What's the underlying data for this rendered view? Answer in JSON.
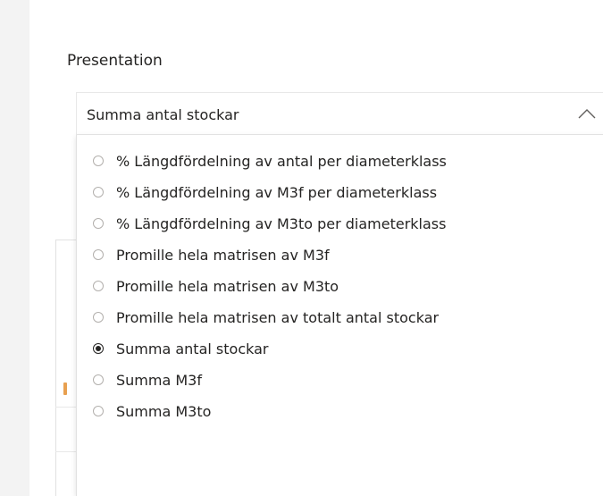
{
  "presentation": {
    "title": "Presentation",
    "selected_value": "Summa antal stockar",
    "chevron_icon": "chevron-up-icon",
    "options": [
      {
        "label": "% Längdfördelning av antal per diameterklass",
        "selected": false
      },
      {
        "label": "% Längdfördelning av M3f per diameterklass",
        "selected": false
      },
      {
        "label": "% Längdfördelning av M3to per diameterklass",
        "selected": false
      },
      {
        "label": "Promille hela matrisen av M3f",
        "selected": false
      },
      {
        "label": "Promille hela matrisen av M3to",
        "selected": false
      },
      {
        "label": "Promille hela matrisen av totalt antal stockar",
        "selected": false
      },
      {
        "label": "Summa antal stockar",
        "selected": true
      },
      {
        "label": "Summa M3f",
        "selected": false
      },
      {
        "label": "Summa M3to",
        "selected": false
      }
    ]
  }
}
